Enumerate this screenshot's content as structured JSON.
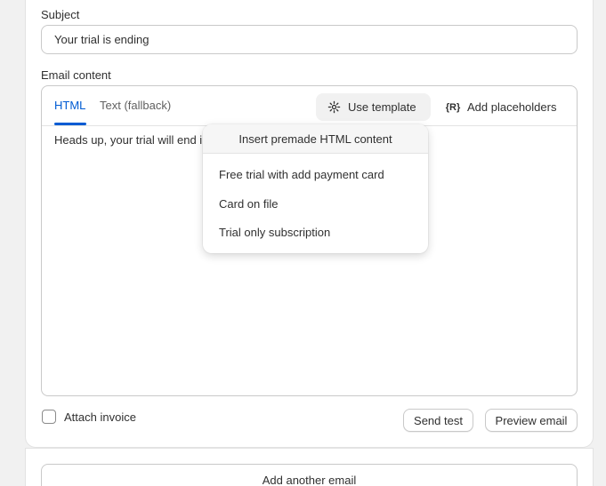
{
  "subject": {
    "label": "Subject",
    "value": "Your trial is ending"
  },
  "email_content": {
    "label": "Email content",
    "tabs": [
      {
        "label": "HTML",
        "active": true
      },
      {
        "label": "Text (fallback)",
        "active": false
      }
    ],
    "use_template_label": "Use template",
    "use_template_icon": "sparkle-icon",
    "add_placeholders_label": "Add placeholders",
    "add_placeholders_icon": "braces-icon",
    "add_placeholders_glyph": "{R}",
    "body_text": "Heads up, your trial will end in"
  },
  "template_menu": {
    "header": "Insert premade HTML content",
    "items": [
      "Free trial with add payment card",
      "Card on file",
      "Trial only subscription"
    ]
  },
  "footer": {
    "attach_invoice_label": "Attach invoice",
    "attach_invoice_checked": false,
    "send_test_label": "Send test",
    "preview_email_label": "Preview email"
  },
  "add_another_email_label": "Add another email",
  "colors": {
    "accent": "#005bd3",
    "border": "#c9c9c9",
    "page_bg": "#f1f1f1"
  }
}
